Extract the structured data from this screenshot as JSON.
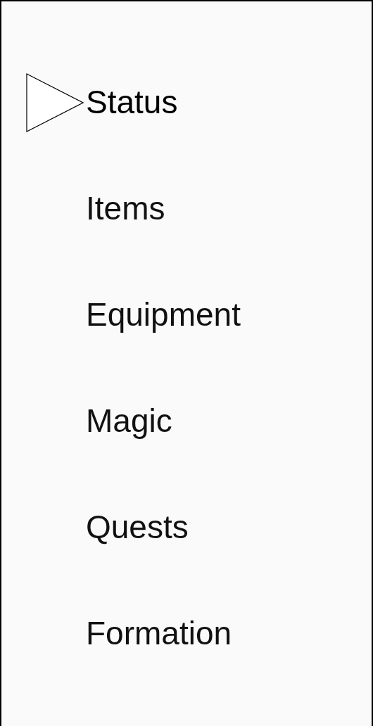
{
  "menu": {
    "items": [
      {
        "label": "Status",
        "selected": true
      },
      {
        "label": "Items",
        "selected": false
      },
      {
        "label": "Equipment",
        "selected": false
      },
      {
        "label": "Magic",
        "selected": false
      },
      {
        "label": "Quests",
        "selected": false
      },
      {
        "label": "Formation",
        "selected": false
      }
    ]
  }
}
